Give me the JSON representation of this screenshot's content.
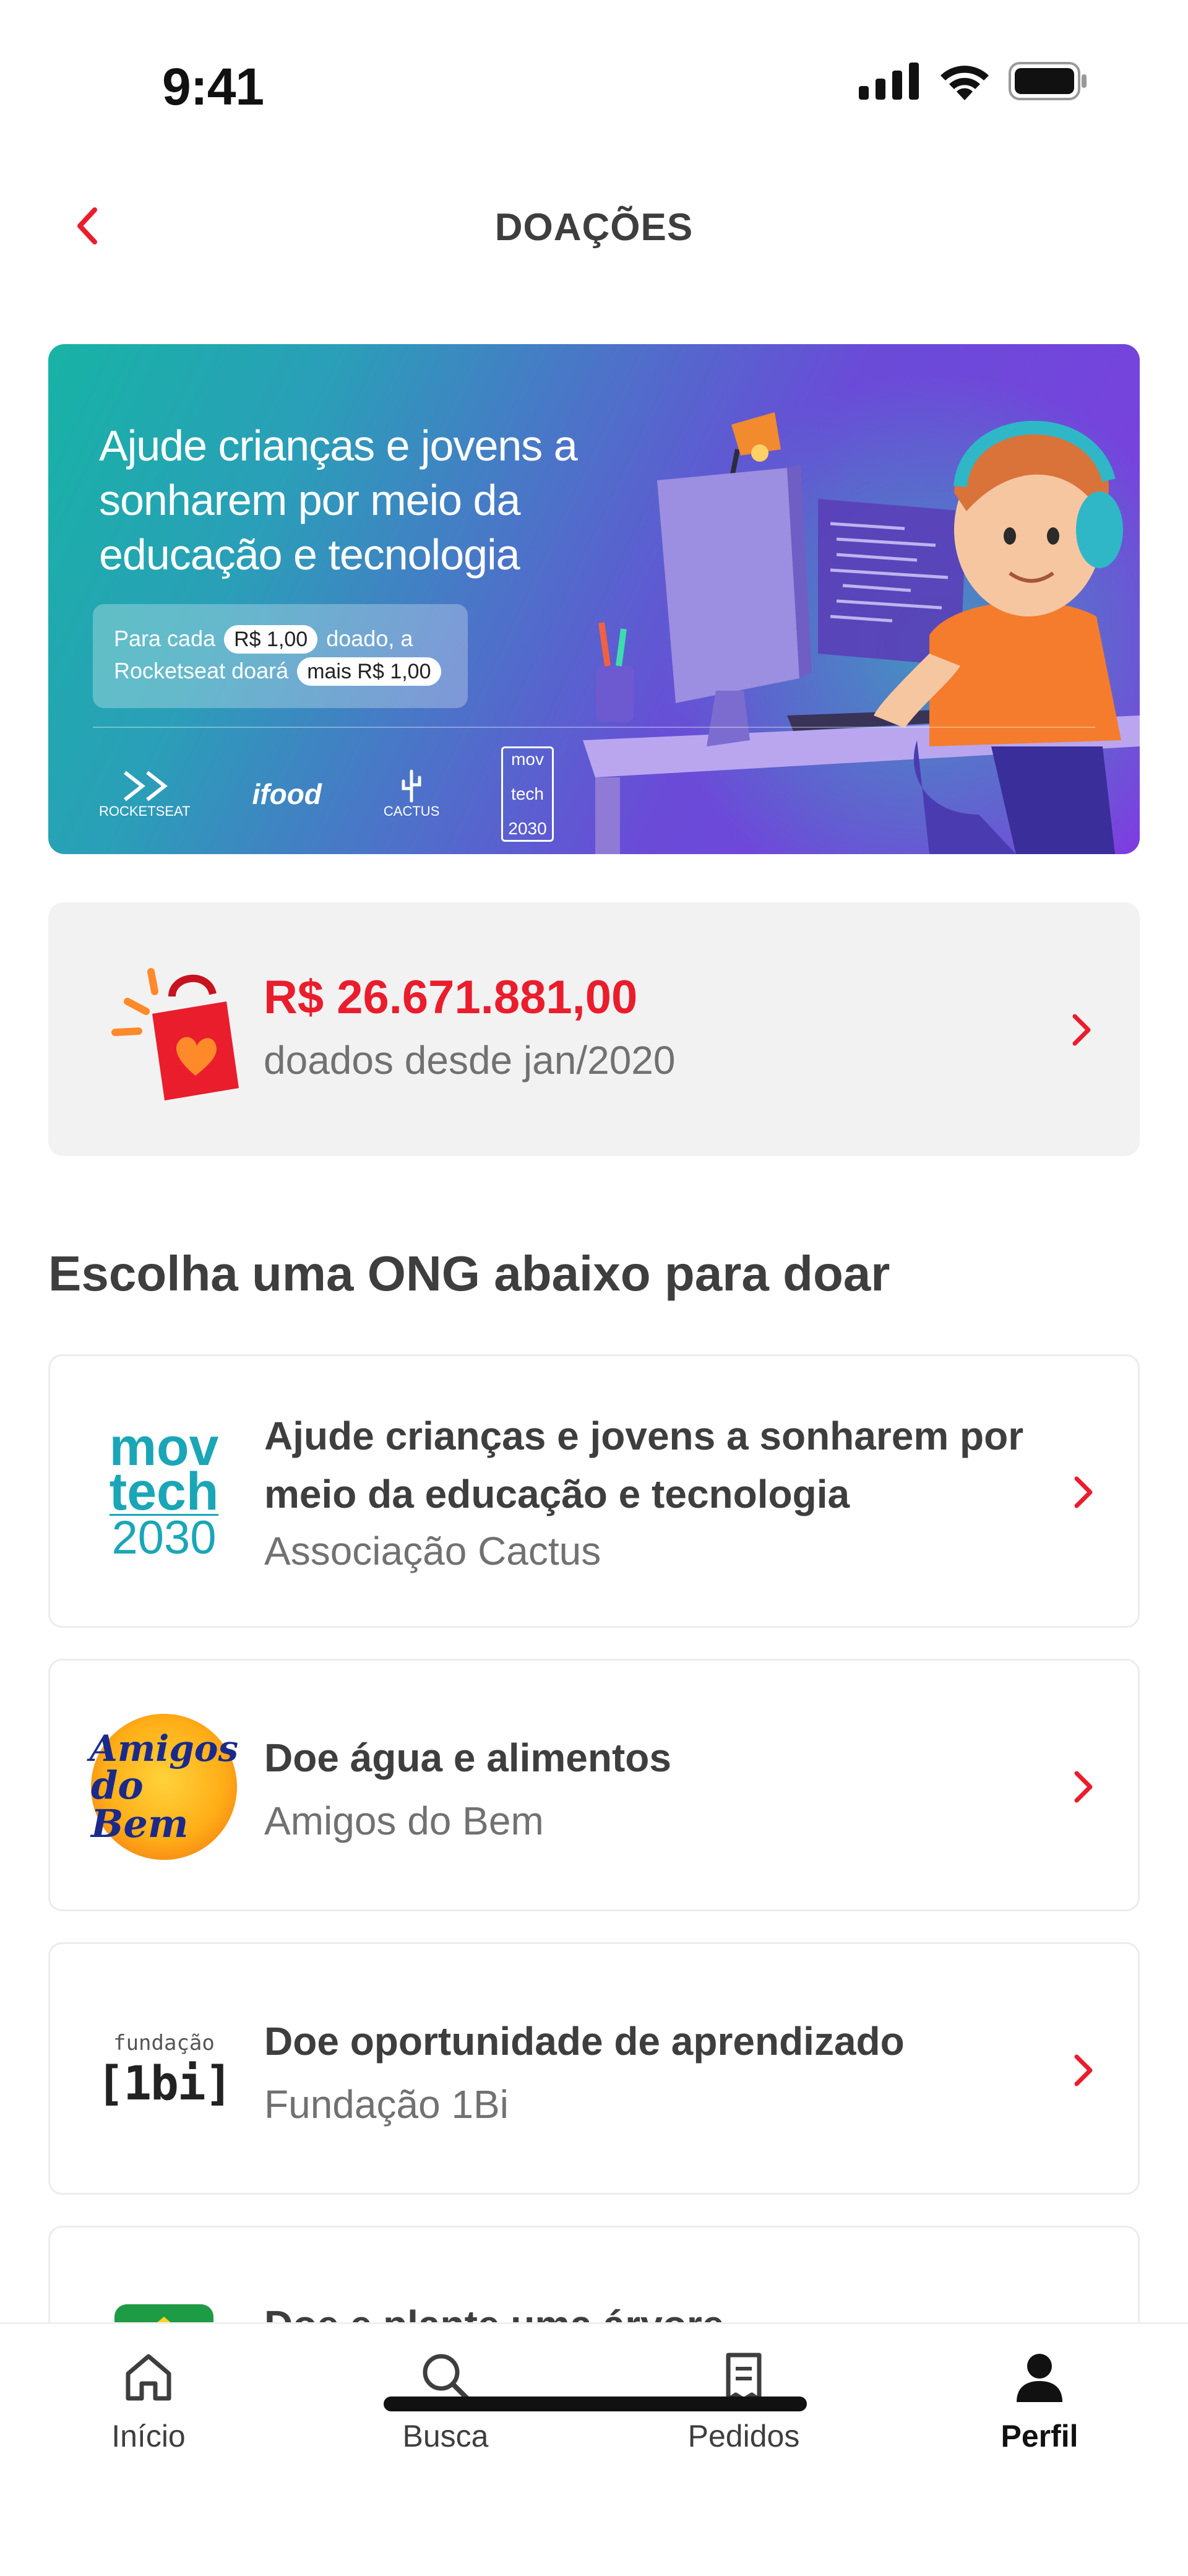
{
  "status_bar": {
    "time": "9:41"
  },
  "header": {
    "title": "DOAÇÕES"
  },
  "banner": {
    "title": "Ajude crianças e jovens a sonharem por meio da educação e tecnologia",
    "box_text_1": "Para cada",
    "box_pill_1": "R$ 1,00",
    "box_text_2": "doado, a",
    "box_text_3": "Rocketseat doará",
    "box_pill_2": "mais R$ 1,00",
    "partners": {
      "rocketseat": "ROCKETSEAT",
      "ifood": "ifood",
      "cactus": "CACTUS",
      "movtech_1": "mov",
      "movtech_2": "tech",
      "movtech_3": "2030"
    }
  },
  "summary": {
    "amount": "R$ 26.671.881,00",
    "subtitle": "doados desde jan/2020"
  },
  "section": {
    "title": "Escolha uma ONG abaixo para doar"
  },
  "ongs": [
    {
      "title": "Ajude crianças e jovens a sonharem por meio da educação e tecnologia",
      "org": "Associação Cactus",
      "logo": {
        "l1": "mov",
        "l2": "tech",
        "l3": "2030"
      }
    },
    {
      "title": "Doe água e alimentos",
      "org": "Amigos do Bem",
      "logo": {
        "l1": "Amigos",
        "l2": "do Bem"
      }
    },
    {
      "title": "Doe oportunidade de aprendizado",
      "org": "Fundação 1Bi",
      "logo": {
        "l1": "fundação",
        "l2": "[1bi]"
      }
    },
    {
      "title": "Doe e plante uma árvore",
      "org": ""
    }
  ],
  "tabs": [
    {
      "label": "Início",
      "icon": "home-icon"
    },
    {
      "label": "Busca",
      "icon": "search-icon"
    },
    {
      "label": "Pedidos",
      "icon": "receipt-icon"
    },
    {
      "label": "Perfil",
      "icon": "user-icon",
      "active": true
    }
  ],
  "colors": {
    "accent": "#ea1d2c",
    "text": "#3e3e3e",
    "muted": "#717171"
  }
}
